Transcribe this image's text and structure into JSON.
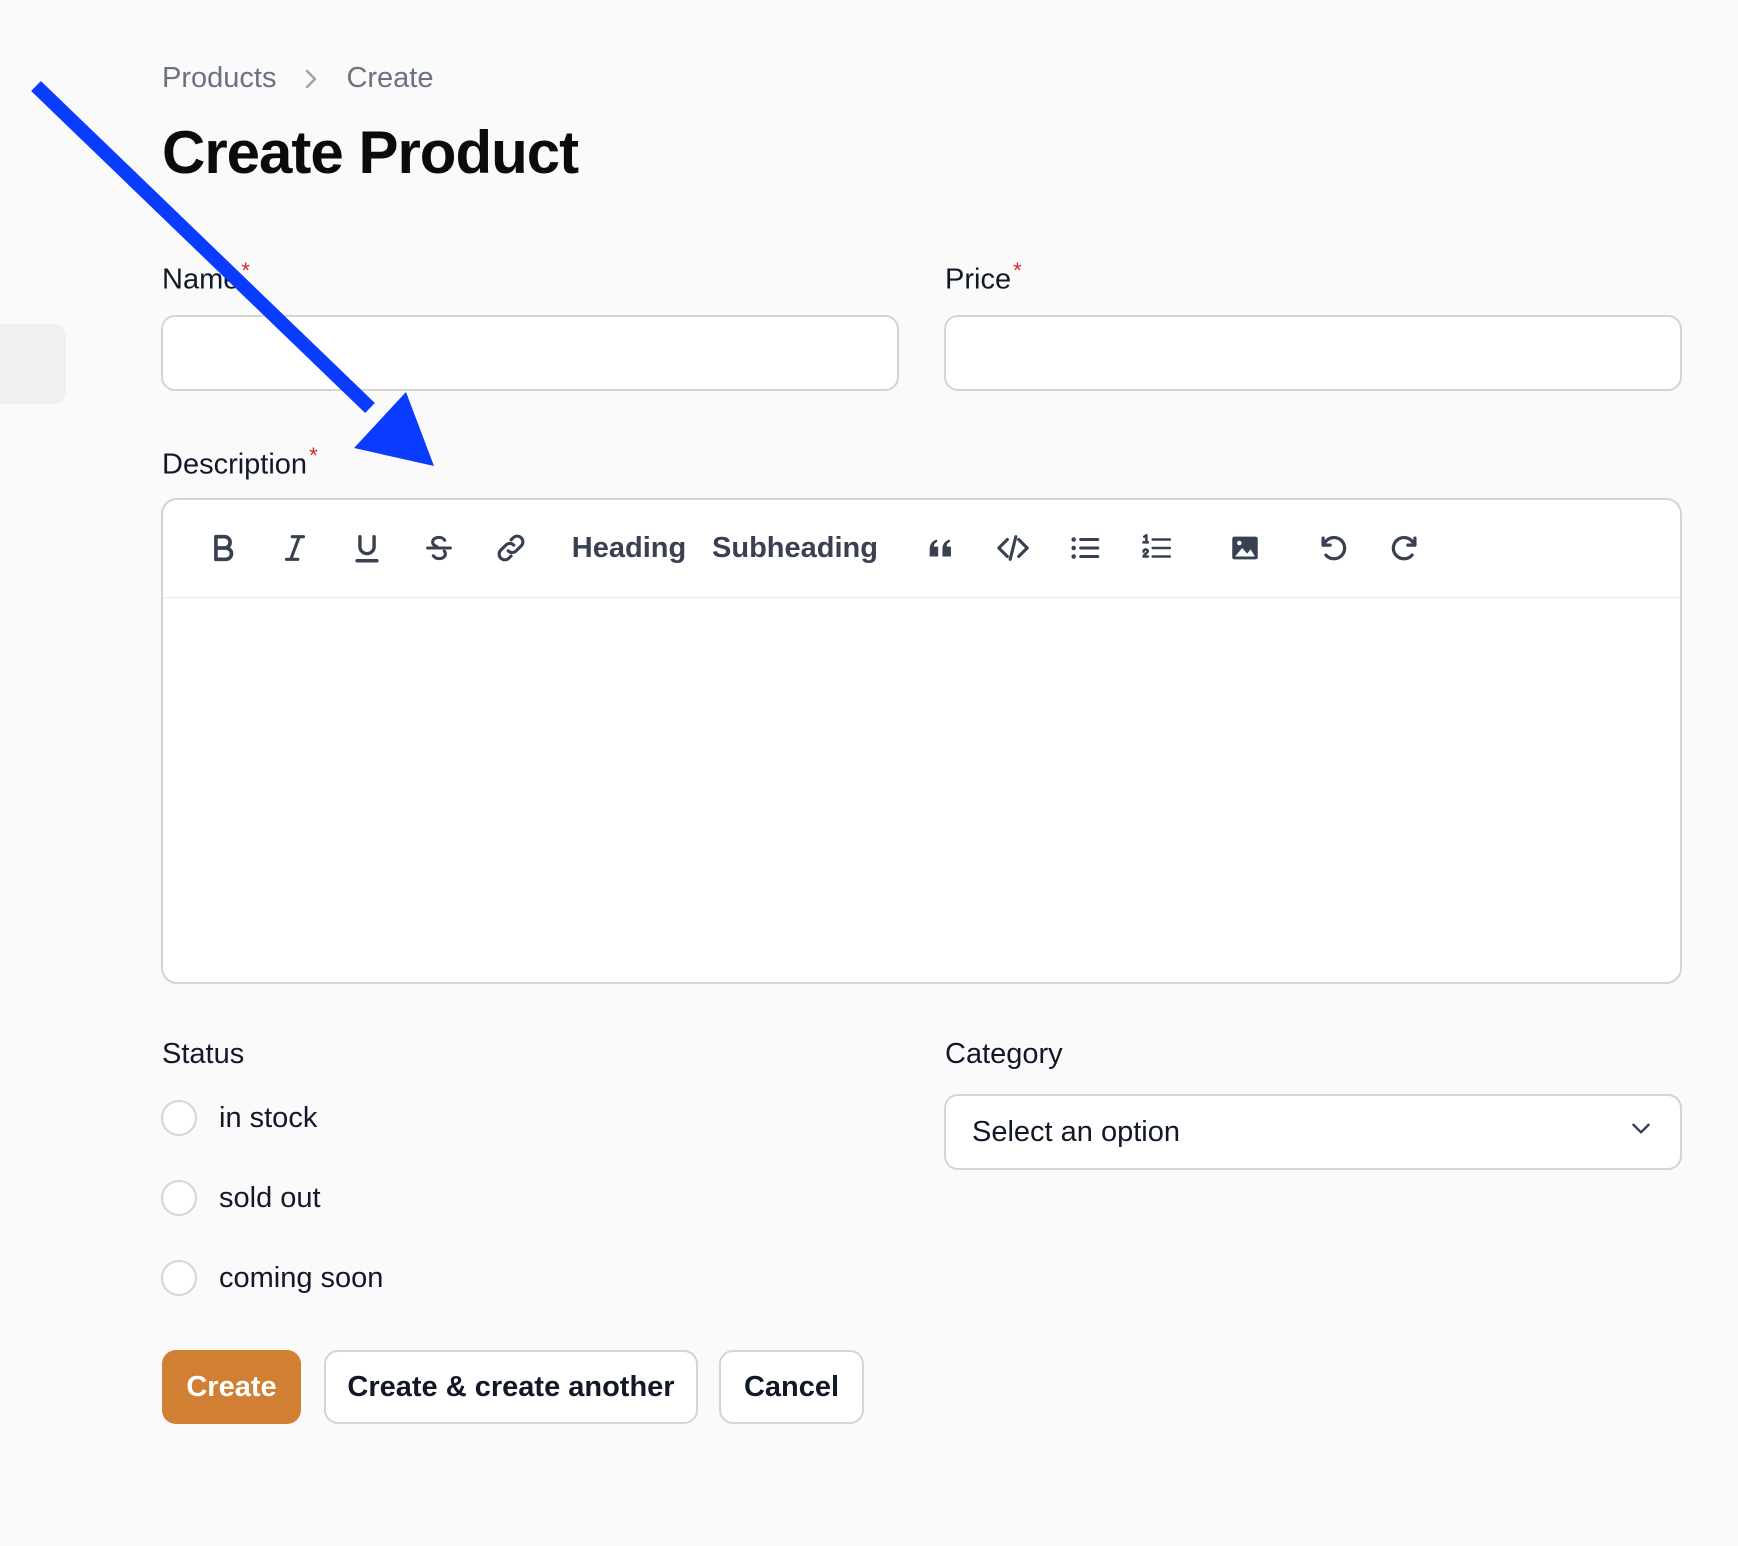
{
  "breadcrumb": {
    "items": [
      "Products",
      "Create"
    ]
  },
  "page": {
    "title": "Create Product"
  },
  "form": {
    "name": {
      "label": "Name",
      "required_mark": "*",
      "value": "",
      "placeholder": ""
    },
    "price": {
      "label": "Price",
      "required_mark": "*",
      "value": "",
      "placeholder": ""
    },
    "description": {
      "label": "Description",
      "required_mark": "*",
      "toolbar": {
        "bold_icon": "bold-icon",
        "italic_icon": "italic-icon",
        "underline_icon": "underline-icon",
        "strike_icon": "strikethrough-icon",
        "link_icon": "link-icon",
        "heading_label": "Heading",
        "subheading_label": "Subheading",
        "quote_icon": "quote-icon",
        "code_icon": "code-icon",
        "bullet_list_icon": "bullet-list-icon",
        "ordered_list_icon": "ordered-list-icon",
        "image_icon": "image-icon",
        "undo_icon": "undo-icon",
        "redo_icon": "redo-icon"
      },
      "value": ""
    },
    "status": {
      "label": "Status",
      "options": [
        "in stock",
        "sold out",
        "coming soon"
      ],
      "selected": null
    },
    "category": {
      "label": "Category",
      "value": "Select an option"
    }
  },
  "actions": {
    "create_label": "Create",
    "create_another_label": "Create & create another",
    "cancel_label": "Cancel"
  },
  "colors": {
    "primary": "#d17f33",
    "required": "#dc2626",
    "annotation_arrow": "#0a3cff",
    "background": "#fafafa"
  }
}
